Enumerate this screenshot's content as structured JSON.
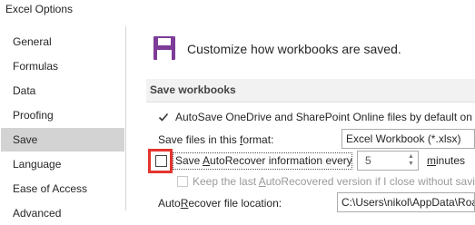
{
  "window": {
    "title": "Excel Options"
  },
  "sidebar": {
    "items": [
      {
        "label": "General"
      },
      {
        "label": "Formulas"
      },
      {
        "label": "Data"
      },
      {
        "label": "Proofing"
      },
      {
        "label": "Save",
        "selected": true
      },
      {
        "label": "Language"
      },
      {
        "label": "Ease of Access"
      },
      {
        "label": "Advanced"
      }
    ]
  },
  "main": {
    "header": {
      "text": "Customize how workbooks are saved.",
      "icon": "save-floppy-icon"
    },
    "section": {
      "title": "Save workbooks"
    },
    "autosave": {
      "label": "AutoSave OneDrive and SharePoint Online files by default on Ex",
      "checked": true
    },
    "format": {
      "label_pre": "Save files in this ",
      "label_u": "f",
      "label_post": "ormat:",
      "value": "Excel Workbook (*.xlsx)"
    },
    "autorecover": {
      "label_pre": "Save ",
      "label_u": "A",
      "label_post": "utoRecover information every",
      "checked": false,
      "value": "5",
      "unit_u": "m",
      "unit_post": "inutes"
    },
    "keep_last": {
      "label_pre": "Keep the last ",
      "label_u": "A",
      "label_post": "utoRecovered version if I close without savin",
      "enabled": false
    },
    "location": {
      "label_pre": "Auto",
      "label_u": "R",
      "label_post": "ecover file location:",
      "value": "C:\\Users\\nikol\\AppData\\Roa"
    }
  },
  "colors": {
    "highlight": "#e3352e",
    "selected_nav": "#d3d3d3",
    "icon_purple": "#7d3c98"
  }
}
